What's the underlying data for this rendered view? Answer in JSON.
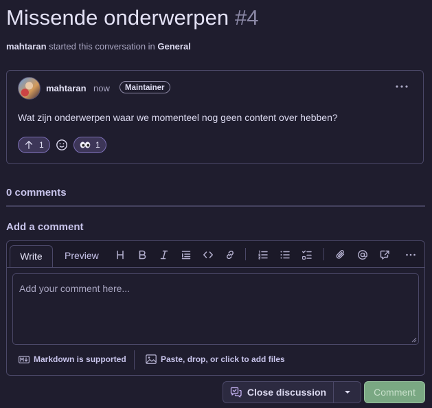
{
  "header": {
    "title": "Missende onderwerpen",
    "number": "#4",
    "subtitle_user": "mahtaran",
    "subtitle_text": " started this conversation in ",
    "subtitle_category": "General"
  },
  "post": {
    "author": "mahtaran",
    "time": "now",
    "badge": "Maintainer",
    "more_icon": "kebab-horizontal-icon",
    "body": "Wat zijn onderwerpen waar we momenteel nog geen content over hebben?",
    "reactions": [
      {
        "icon": "arrow-up-icon",
        "count": "1"
      },
      {
        "icon": "eyes-icon",
        "count": "1"
      }
    ],
    "add_reaction_icon": "smiley-icon"
  },
  "comments": {
    "count_label": "0 comments",
    "add_label": "Add a comment"
  },
  "editor": {
    "tab_write": "Write",
    "tab_preview": "Preview",
    "toolbar": [
      "heading-icon",
      "bold-icon",
      "italic-icon",
      "quote-icon",
      "code-icon",
      "link-icon",
      "ordered-list-icon",
      "unordered-list-icon",
      "task-list-icon",
      "paperclip-icon",
      "mention-icon",
      "cross-reference-icon",
      "more-icon"
    ],
    "placeholder": "Add your comment here...",
    "markdown_label": "Markdown is supported",
    "files_label": "Paste, drop, or click to add files"
  },
  "actions": {
    "close_label": "Close discussion",
    "comment_label": "Comment"
  },
  "colors": {
    "background": "#1f1d2e",
    "border": "#4b4868",
    "comment_button": "#7aa883",
    "reaction_active": "#3d3658"
  }
}
